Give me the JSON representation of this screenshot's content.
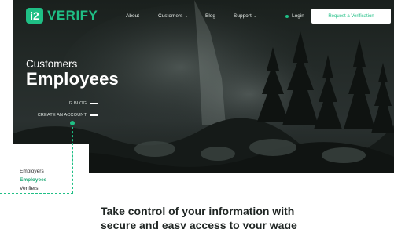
{
  "brand": {
    "badge": "i2",
    "name": "VERIFY"
  },
  "nav": {
    "items": [
      {
        "label": "About",
        "has_dropdown": false
      },
      {
        "label": "Customers",
        "has_dropdown": true
      },
      {
        "label": "Blog",
        "has_dropdown": false
      },
      {
        "label": "Support",
        "has_dropdown": true
      }
    ],
    "login": "Login",
    "cta": "Request a Verification"
  },
  "hero": {
    "subtitle": "Customers",
    "title": "Employees",
    "links": [
      "I2 BLOG",
      "CREATE AN ACCOUNT"
    ]
  },
  "submenu": {
    "items": [
      {
        "label": "Employers",
        "active": false
      },
      {
        "label": "Employees",
        "active": true
      },
      {
        "label": "Verifiers",
        "active": false
      }
    ]
  },
  "content": {
    "headline_line1": "Take control of your information with",
    "headline_line2": "secure and easy access to your wage"
  },
  "colors": {
    "accent": "#1fbf85",
    "hero_dark": "#1d2320",
    "text_dark": "#1f2523"
  }
}
